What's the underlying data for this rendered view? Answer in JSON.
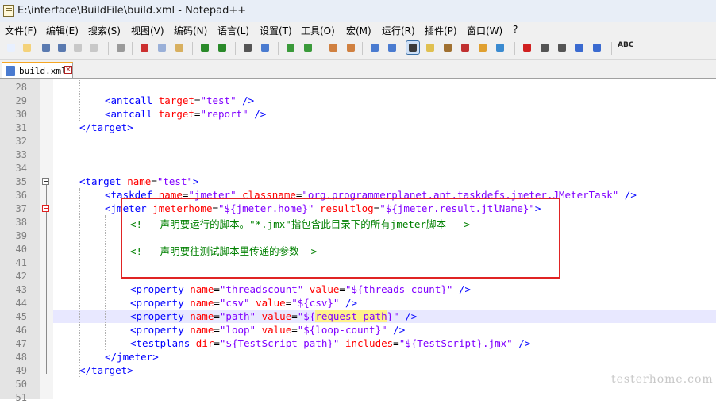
{
  "window": {
    "title": "E:\\interface\\BuildFile\\build.xml - Notepad++"
  },
  "menu": [
    "文件(F)",
    "编辑(E)",
    "搜索(S)",
    "视图(V)",
    "编码(N)",
    "语言(L)",
    "设置(T)",
    "工具(O)",
    "宏(M)",
    "运行(R)",
    "插件(P)",
    "窗口(W)",
    "?"
  ],
  "toolbar_icons": [
    "new-icon",
    "open-icon",
    "save-icon",
    "save-all-icon",
    "close-icon",
    "close-all-icon",
    "print-icon",
    "cut-icon",
    "copy-icon",
    "paste-icon",
    "undo-icon",
    "redo-icon",
    "find-icon",
    "replace-icon",
    "zoom-in-icon",
    "zoom-out-icon",
    "sync-v-icon",
    "sync-h-icon",
    "word-wrap-icon",
    "show-all-chars-icon",
    "indent-guide-icon",
    "udl-icon",
    "doc-map-icon",
    "function-list-icon",
    "folder-workspace-icon",
    "monitor-icon",
    "record-macro-icon",
    "stop-macro-icon",
    "play-macro-icon",
    "run-macro-multi-icon",
    "save-macro-icon",
    "spellcheck-icon"
  ],
  "tab": {
    "label": "build.xml",
    "close": "×"
  },
  "editor": {
    "current_line": "45",
    "lines": [
      {
        "num": "28",
        "text": ""
      },
      {
        "num": "29",
        "text": "<antcall target=\"test\" />"
      },
      {
        "num": "30",
        "text": "<antcall target=\"report\" />"
      },
      {
        "num": "31",
        "text": "</target>"
      },
      {
        "num": "32",
        "text": ""
      },
      {
        "num": "33",
        "text": ""
      },
      {
        "num": "34",
        "text": ""
      },
      {
        "num": "35",
        "text": "<target name=\"test\">"
      },
      {
        "num": "36",
        "text": "<taskdef name=\"jmeter\" classname=\"org.programmerplanet.ant.taskdefs.jmeter.JMeterTask\" />"
      },
      {
        "num": "37",
        "text": "<jmeter jmeterhome=\"${jmeter.home}\" resultlog=\"${jmeter.result.jtlName}\">"
      },
      {
        "num": "38",
        "text": "<!-- 声明要运行的脚本。\"*.jmx\"指包含此目录下的所有jmeter脚本 -->"
      },
      {
        "num": "39",
        "text": ""
      },
      {
        "num": "40",
        "text": "<!-- 声明要往测试脚本里传递的参数-->"
      },
      {
        "num": "41",
        "text": ""
      },
      {
        "num": "42",
        "text": ""
      },
      {
        "num": "43",
        "text": "<property name=\"threadscount\" value=\"${threads-count}\" />"
      },
      {
        "num": "44",
        "text": "<property name=\"csv\" value=\"${csv}\" />"
      },
      {
        "num": "45",
        "text": "<property name=\"path\" value=\"${request-path}\" />"
      },
      {
        "num": "46",
        "text": "<property name=\"loop\" value=\"${loop-count}\" />"
      },
      {
        "num": "47",
        "text": "<testplans dir=\"${TestScript-path}\" includes=\"${TestScript}.jmx\" />"
      },
      {
        "num": "48",
        "text": "</jmeter>"
      },
      {
        "num": "49",
        "text": "</target>"
      },
      {
        "num": "50",
        "text": ""
      },
      {
        "num": "51",
        "text": ""
      }
    ]
  },
  "watermark": "testerhome.com",
  "colors": {
    "tag": "#0000ff",
    "attribute": "#ff0000",
    "value": "#8000ff",
    "comment": "#008000",
    "highlight": "#fff28a",
    "annotation_box": "#e02424"
  }
}
